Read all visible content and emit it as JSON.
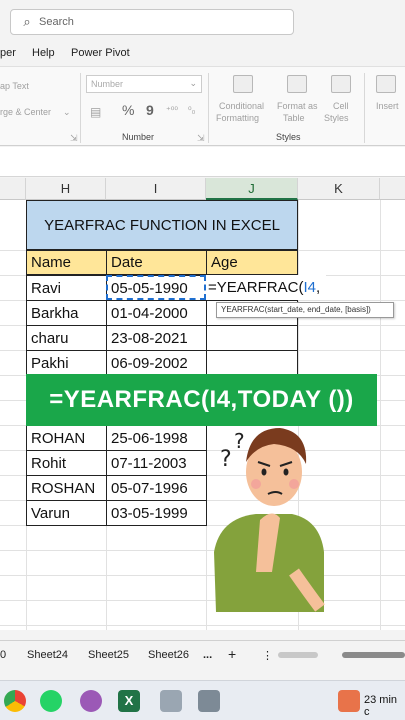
{
  "search": {
    "placeholder": "Search"
  },
  "menu": [
    "per",
    "Help",
    "Power Pivot"
  ],
  "ribbon": {
    "wrap_text": "ap Text",
    "merge_center": "rge & Center",
    "number_format": "Number",
    "number_group": "Number",
    "conditional_formatting": [
      "Conditional",
      "Formatting"
    ],
    "format_as_table": [
      "Format as",
      "Table"
    ],
    "cell_styles": [
      "Cell",
      "Styles"
    ],
    "styles_group": "Styles",
    "insert": "Insert",
    "percent_symbol": "%",
    "comma_symbol": "9"
  },
  "columns": [
    "H",
    "I",
    "J",
    "K"
  ],
  "sheet": {
    "title": "YEARFRAC FUNCTION IN EXCEL",
    "headers": [
      "Name",
      "Date",
      "Age"
    ],
    "rows": [
      {
        "name": "Ravi",
        "date": "05-05-1990"
      },
      {
        "name": "Barkha",
        "date": "01-04-2000"
      },
      {
        "name": "charu",
        "date": "23-08-2021"
      },
      {
        "name": "Pakhi",
        "date": "06-09-2002"
      },
      {
        "name": "ROHAN",
        "date": "25-06-1998"
      },
      {
        "name": "Rohit",
        "date": "07-11-2003"
      },
      {
        "name": "ROSHAN",
        "date": "05-07-1996"
      },
      {
        "name": "Varun",
        "date": "03-05-1999"
      }
    ]
  },
  "formula": {
    "prefix": "=YEARFRAC(",
    "ref": "I4",
    "suffix": ","
  },
  "tooltip": "YEARFRAC(start_date, end_date, [basis])",
  "banner": "=YEARFRAC(I4,TODAY ())",
  "sheet_tabs": [
    "0",
    "Sheet24",
    "Sheet25",
    "Sheet26",
    "...",
    "+",
    "⋮"
  ],
  "taskbar": {
    "time_text": "23 min c"
  },
  "colors": {
    "excel_green": "#217346",
    "banner_green": "#1aa74a",
    "title_fill": "#bdd7ee",
    "header_fill": "#ffe699"
  }
}
